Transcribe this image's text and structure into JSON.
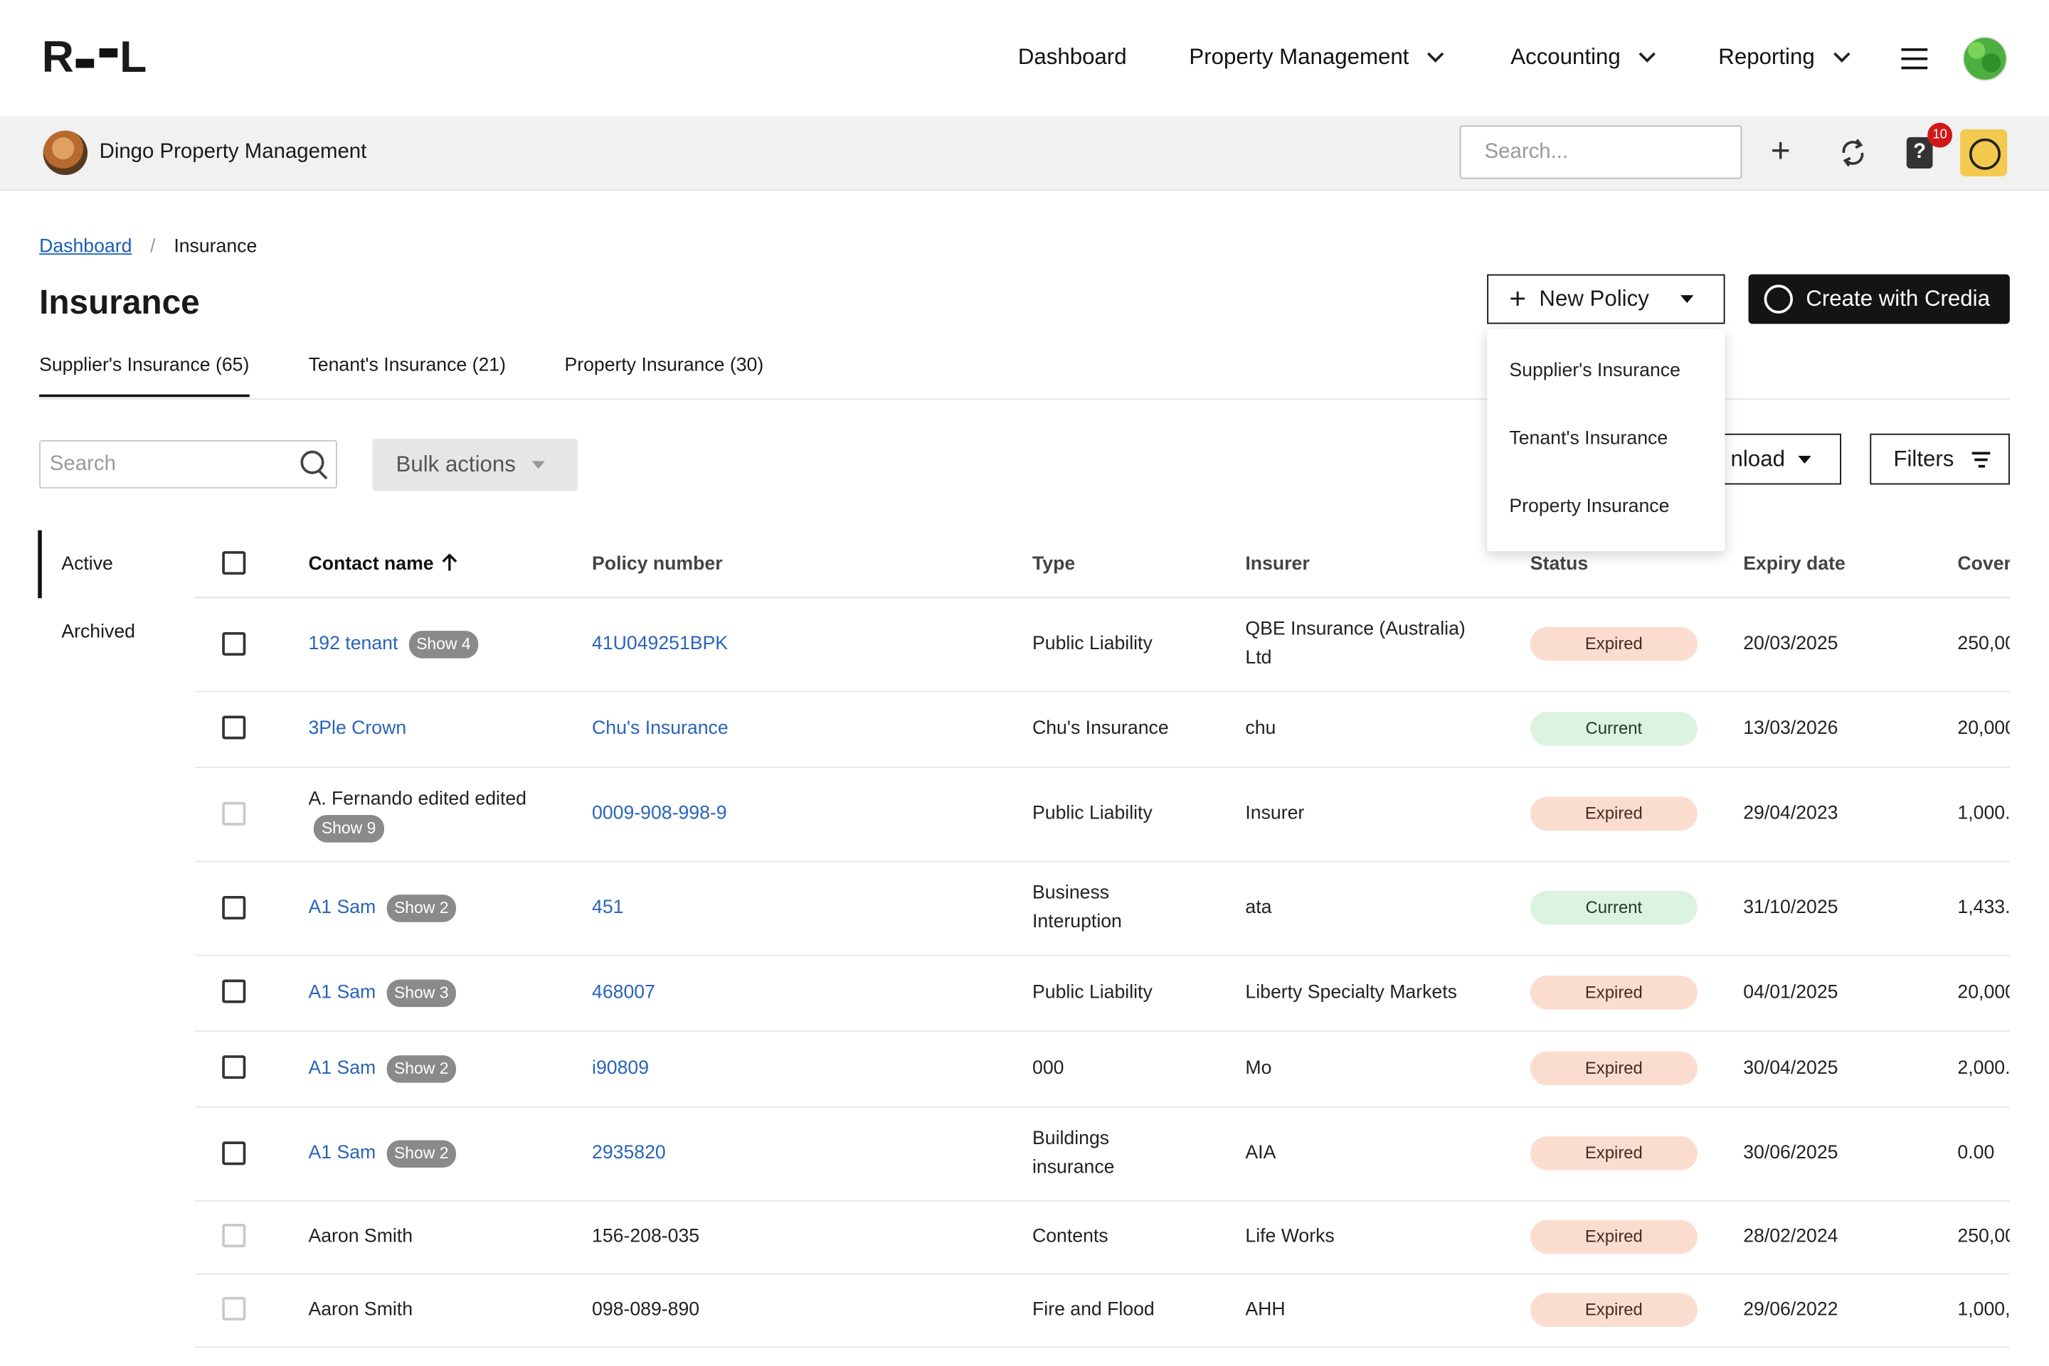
{
  "nav": {
    "logo_left": "R",
    "logo_right": "L",
    "items": [
      "Dashboard",
      "Property Management",
      "Accounting",
      "Reporting"
    ]
  },
  "org": {
    "name": "Dingo Property Management"
  },
  "header": {
    "search_placeholder": "Search...",
    "notifications": "10",
    "help": "?"
  },
  "breadcrumb": {
    "root": "Dashboard",
    "sep": "/",
    "current": "Insurance"
  },
  "page": {
    "title": "Insurance"
  },
  "tabs": [
    "Supplier's Insurance (65)",
    "Tenant's Insurance (21)",
    "Property Insurance (30)"
  ],
  "actions": {
    "new_policy": "New Policy",
    "create_with": "Create with Credia",
    "menu": [
      "Supplier's Insurance",
      "Tenant's Insurance",
      "Property Insurance"
    ],
    "search_placeholder": "Search",
    "bulk": "Bulk actions",
    "download": "nload",
    "filters": "Filters"
  },
  "sidebar": [
    "Active",
    "Archived"
  ],
  "table": {
    "headers": [
      "Contact name",
      "Policy number",
      "Type",
      "Insurer",
      "Status",
      "Expiry date",
      "Cover"
    ],
    "rows": [
      {
        "contact": "192 tenant",
        "show": "Show 4",
        "policy": "41U049251BPK",
        "type": "Public Liability",
        "insurer": "QBE Insurance (Australia) Ltd",
        "status": "Expired",
        "expiry": "20/03/2025",
        "cover": "250,00"
      },
      {
        "contact": "3Ple Crown",
        "show": "",
        "policy": "Chu's Insurance",
        "type": "Chu's Insurance",
        "insurer": "chu",
        "status": "Current",
        "expiry": "13/03/2026",
        "cover": "20,000"
      },
      {
        "contact": "A. Fernando edited edited",
        "show": "Show 9",
        "policy": "0009-908-998-9",
        "type": "Public Liability",
        "insurer": "Insurer",
        "status": "Expired",
        "expiry": "29/04/2023",
        "cover": "1,000."
      },
      {
        "contact": "A1 Sam",
        "show": "Show 2",
        "policy": "451",
        "type": "Business Interuption",
        "insurer": "ata",
        "status": "Current",
        "expiry": "31/10/2025",
        "cover": "1,433."
      },
      {
        "contact": "A1 Sam",
        "show": "Show 3",
        "policy": "468007",
        "type": "Public Liability",
        "insurer": "Liberty Specialty Markets",
        "status": "Expired",
        "expiry": "04/01/2025",
        "cover": "20,000"
      },
      {
        "contact": "A1 Sam",
        "show": "Show 2",
        "policy": "i90809",
        "type": "000",
        "insurer": "Mo",
        "status": "Expired",
        "expiry": "30/04/2025",
        "cover": "2,000."
      },
      {
        "contact": "A1 Sam",
        "show": "Show 2",
        "policy": "2935820",
        "type": "Buildings insurance",
        "insurer": "AIA",
        "status": "Expired",
        "expiry": "30/06/2025",
        "cover": "0.00"
      },
      {
        "contact": "Aaron Smith",
        "show": "",
        "policy": "156-208-035",
        "type": "Contents",
        "insurer": "Life Works",
        "status": "Expired",
        "expiry": "28/02/2024",
        "cover": "250,00"
      },
      {
        "contact": "Aaron Smith",
        "show": "",
        "policy": "098-089-890",
        "type": "Fire and Flood",
        "insurer": "AHH",
        "status": "Expired",
        "expiry": "29/06/2022",
        "cover": "1,000,"
      }
    ]
  },
  "colors": {
    "link": "#2a64b8",
    "expired_bg": "#fbddd0",
    "current_bg": "#ddf3e2",
    "brand_yellow": "#f3c94f"
  }
}
